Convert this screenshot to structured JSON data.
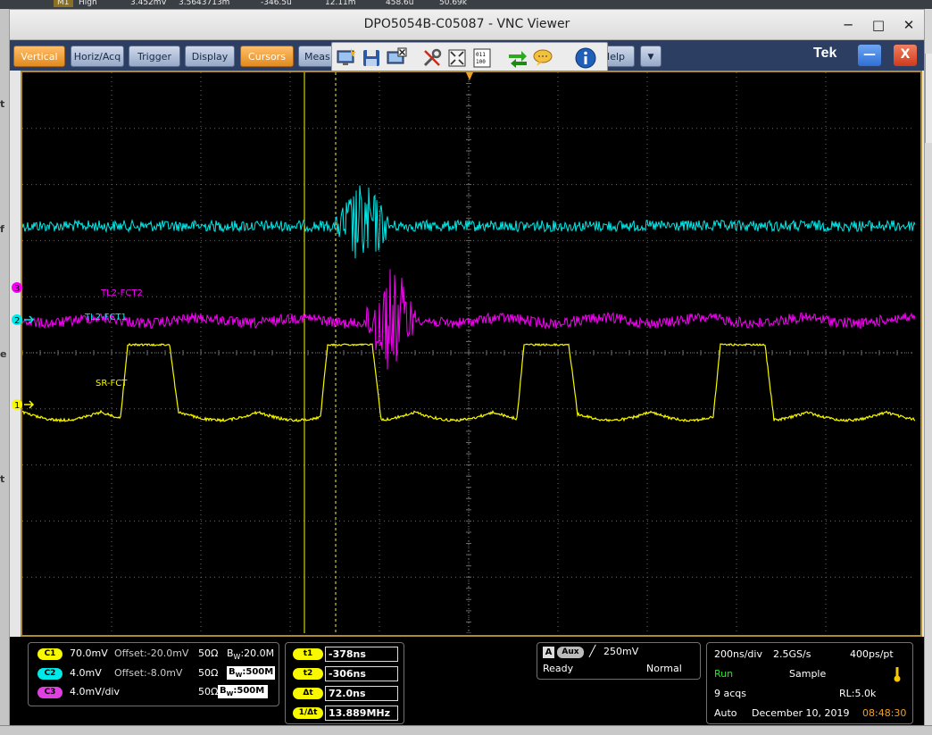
{
  "background_strip": {
    "label": "M1",
    "high": "High",
    "v1": "3.452mV",
    "v2": "3.5643713m",
    "v3": "-346.5u",
    "v4": "12.11m",
    "v5": "458.6u",
    "v6": "50.69k"
  },
  "window": {
    "title": "DPO5054B-C05087 - VNC Viewer",
    "min": "─",
    "max": "□",
    "close": "✕"
  },
  "left_edge": [
    "t",
    "f",
    "e",
    "t"
  ],
  "menu": {
    "items": [
      {
        "label": "Vertical",
        "active": true
      },
      {
        "label": "Horiz/Acq",
        "active": false
      },
      {
        "label": "Trigger",
        "active": false
      },
      {
        "label": "Display",
        "active": false
      },
      {
        "label": "Cursors",
        "active": true
      },
      {
        "label": "Meas",
        "active": false
      },
      {
        "label": "Help",
        "active": false
      }
    ],
    "dropdown": "▼",
    "brand": "Tek",
    "minimize": "—",
    "close": "X"
  },
  "vnc_toolbar": {
    "icons": [
      "monitor-plus-icon",
      "save-icon",
      "monitor-close-icon",
      "tools-icon",
      "fullscreen-icon",
      "binary-icon",
      "transfer-icon",
      "chat-icon",
      "info-icon"
    ],
    "info_glyph": "i",
    "bin_glyph": "011\n100"
  },
  "colors": {
    "ch1": "#f8f800",
    "ch2": "#00e8e8",
    "ch3": "#f800f8",
    "grid": "#6a6a6a",
    "cursor": "#f8f800",
    "trigger": "#f0a020"
  },
  "channels": [
    {
      "id": "1",
      "name": "SR-FCT",
      "color": "#f8f800"
    },
    {
      "id": "2",
      "name": "TL2-FCT1",
      "color": "#00e8e8"
    },
    {
      "id": "3",
      "name": "TL2-FCT2",
      "color": "#f800f8"
    }
  ],
  "channel_panel": [
    {
      "badge": "C1",
      "scale": "70.0mV",
      "offset": "Offset:-20.0mV",
      "imp": "50Ω",
      "bw_prefix": "B",
      "bw_sub": "W",
      "bw": ":20.0M",
      "color": "#f8f800",
      "bw_boxed": false
    },
    {
      "badge": "C2",
      "scale": "4.0mV",
      "offset": "Offset:-8.0mV",
      "imp": "50Ω",
      "bw_prefix": "B",
      "bw_sub": "W",
      "bw": ":500M",
      "color": "#00e8e8",
      "bw_boxed": true
    },
    {
      "badge": "C3",
      "scale": "4.0mV/div",
      "offset": "",
      "imp": "50Ω",
      "bw_prefix": "B",
      "bw_sub": "W",
      "bw": ":500M",
      "color": "#e040e0",
      "bw_boxed": true
    }
  ],
  "cursor_panel": [
    {
      "label": "t1",
      "value": "-378ns"
    },
    {
      "label": "t2",
      "value": "-306ns"
    },
    {
      "label": "Δt",
      "value": "72.0ns"
    },
    {
      "label": "1/Δt",
      "value": "13.889MHz"
    }
  ],
  "trigger_panel": {
    "a": "A",
    "source": "Aux",
    "slope": "╱",
    "level": "250mV",
    "state": "Ready",
    "mode": "Normal"
  },
  "acq_panel": {
    "timebase": "200ns/div",
    "rate": "2.5GS/s",
    "res": "400ps/pt",
    "run": "Run",
    "acq_mode": "Sample",
    "acqs": "9 acqs",
    "rl": "RL:5.0k",
    "trig_mode": "Auto",
    "date": "December 10, 2019",
    "time": "08:48:30",
    "thermo_color": "#f8c800"
  }
}
